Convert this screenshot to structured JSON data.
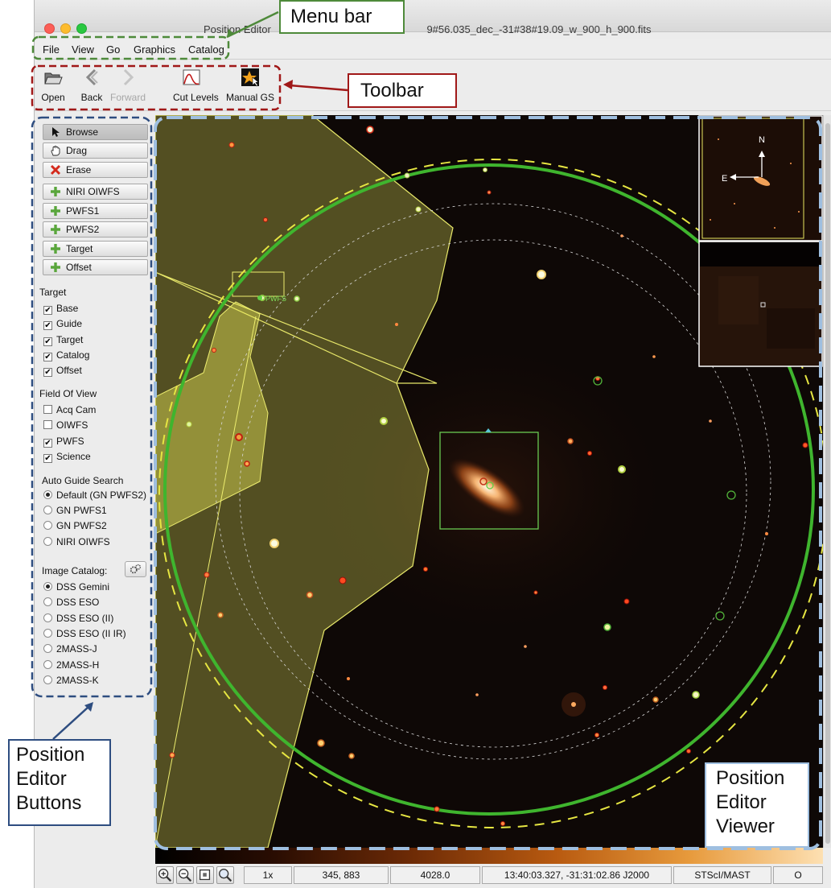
{
  "window": {
    "title": "Position Editor",
    "title_suffix": "9#56.035_dec_-31#38#19.09_w_900_h_900.fits"
  },
  "menubar": {
    "items": [
      "File",
      "View",
      "Go",
      "Graphics",
      "Catalog"
    ]
  },
  "toolbar": {
    "open": "Open",
    "back": "Back",
    "forward": "Forward",
    "cut_levels": "Cut Levels",
    "manual_gs": "Manual GS"
  },
  "sidebar": {
    "buttons": [
      "Browse",
      "Drag",
      "Erase",
      "NIRI OIWFS",
      "PWFS1",
      "PWFS2",
      "Target",
      "Offset"
    ],
    "target_section": {
      "title": "Target",
      "options": [
        {
          "label": "Base",
          "checked": true
        },
        {
          "label": "Guide",
          "checked": true
        },
        {
          "label": "Target",
          "checked": true
        },
        {
          "label": "Catalog",
          "checked": true
        },
        {
          "label": "Offset",
          "checked": true
        }
      ]
    },
    "fov_section": {
      "title": "Field Of View",
      "options": [
        {
          "label": "Acq Cam",
          "checked": false
        },
        {
          "label": "OIWFS",
          "checked": false
        },
        {
          "label": "PWFS",
          "checked": true
        },
        {
          "label": "Science",
          "checked": true
        }
      ]
    },
    "auto_guide_section": {
      "title": "Auto Guide Search",
      "options": [
        {
          "label": "Default (GN PWFS2)",
          "selected": true
        },
        {
          "label": "GN PWFS1",
          "selected": false
        },
        {
          "label": "GN PWFS2",
          "selected": false
        },
        {
          "label": "NIRI OIWFS",
          "selected": false
        }
      ]
    },
    "image_catalog_section": {
      "title": "Image Catalog:",
      "options": [
        {
          "label": "DSS Gemini",
          "selected": true
        },
        {
          "label": "DSS ESO",
          "selected": false
        },
        {
          "label": "DSS ESO (II)",
          "selected": false
        },
        {
          "label": "DSS ESO (II IR)",
          "selected": false
        },
        {
          "label": "2MASS-J",
          "selected": false
        },
        {
          "label": "2MASS-H",
          "selected": false
        },
        {
          "label": "2MASS-K",
          "selected": false
        }
      ]
    }
  },
  "viewer": {
    "compass_north": "N",
    "compass_east": "E",
    "guide_probe_label": "PWFS"
  },
  "statusbar": {
    "zoom": "1x",
    "pixel_coords": "345, 883",
    "pixel_value": "4028.0",
    "world_coords": "13:40:03.327, -31:31:02.86 J2000",
    "image_source": "STScI/MAST",
    "extra": "O"
  },
  "annotations": {
    "menu_bar": "Menu bar",
    "toolbar": "Toolbar",
    "buttons": [
      "Position",
      "Editor",
      "Buttons"
    ],
    "viewer": [
      "Position",
      "Editor",
      "Viewer"
    ],
    "colors": {
      "menu": "#4e8a3a",
      "toolbar": "#a01818",
      "buttons": "#2e4d80",
      "viewer": "#9fbfe0"
    }
  }
}
